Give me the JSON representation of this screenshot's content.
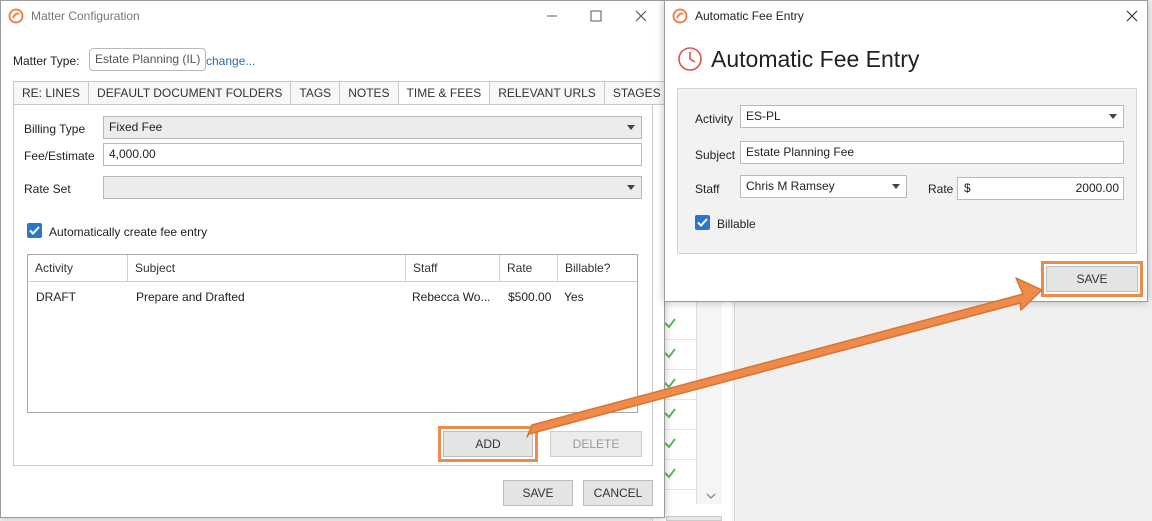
{
  "matter_window": {
    "title": "Matter Configuration",
    "matter_type_label": "Matter Type:",
    "matter_type_value": "Estate Planning (IL)",
    "change_link": "change...",
    "tabs": [
      {
        "label": "RE: LINES"
      },
      {
        "label": "DEFAULT DOCUMENT FOLDERS"
      },
      {
        "label": "TAGS"
      },
      {
        "label": "NOTES"
      },
      {
        "label": "TIME & FEES",
        "active": true
      },
      {
        "label": "RELEVANT URLS"
      },
      {
        "label": "STAGES"
      }
    ],
    "billing_type_label": "Billing Type",
    "billing_type_value": "Fixed Fee",
    "fee_estimate_label": "Fee/Estimate",
    "fee_estimate_value": "4,000.00",
    "rate_set_label": "Rate Set",
    "rate_set_value": "",
    "auto_fee_label": "Automatically create fee entry",
    "auto_fee_checked": true,
    "table": {
      "columns": [
        "Activity",
        "Subject",
        "Staff",
        "Rate",
        "Billable?"
      ],
      "rows": [
        {
          "activity": "DRAFT",
          "subject": "Prepare and Drafted",
          "staff": "Rebecca Wo...",
          "rate": "$500.00",
          "billable": "Yes"
        }
      ]
    },
    "add_button": "ADD",
    "delete_button": "DELETE",
    "save_button": "SAVE",
    "cancel_button": "CANCEL"
  },
  "fee_window": {
    "title": "Automatic Fee Entry",
    "heading": "Automatic Fee Entry",
    "activity_label": "Activity",
    "activity_value": "ES-PL",
    "subject_label": "Subject",
    "subject_value": "Estate Planning Fee",
    "staff_label": "Staff",
    "staff_value": "Chris M Ramsey",
    "rate_label": "Rate",
    "rate_currency": "$",
    "rate_value": "2000.00",
    "billable_label": "Billable",
    "billable_checked": true,
    "save_button": "SAVE"
  },
  "colors": {
    "accent": "#2b78c9",
    "highlight": "#ee8a4a",
    "brand": "#e8854a",
    "check": "#5cb85c"
  }
}
